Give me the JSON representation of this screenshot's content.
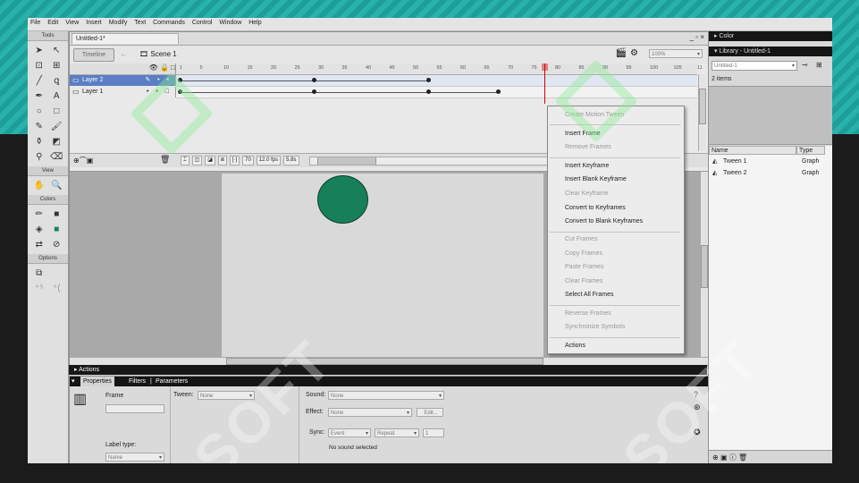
{
  "menu": [
    "File",
    "Edit",
    "View",
    "Insert",
    "Modify",
    "Text",
    "Commands",
    "Control",
    "Window",
    "Help"
  ],
  "tools": {
    "title": "Tools",
    "view_label": "View",
    "colors_label": "Colors",
    "options_label": "Options"
  },
  "document": {
    "tab": "Untitled-1*",
    "window_buttons": "_ ▫ ×"
  },
  "editbar": {
    "timeline_button": "Timeline",
    "scene": "Scene 1",
    "zoom": "100%"
  },
  "timeline": {
    "ruler": [
      "1",
      "5",
      "10",
      "15",
      "20",
      "25",
      "30",
      "35",
      "40",
      "45",
      "50",
      "55",
      "60",
      "65",
      "70",
      "75",
      "80",
      "85",
      "90",
      "95",
      "100",
      "105",
      "11"
    ],
    "layers": [
      {
        "name": "Layer 2",
        "selected": true
      },
      {
        "name": "Layer 1",
        "selected": false
      }
    ],
    "status": {
      "frame": "70",
      "fps": "12.0 fps",
      "time": "5.8s"
    }
  },
  "context_menu": [
    {
      "label": "Create Motion Tween",
      "enabled": false
    },
    {
      "label": "Insert Frame",
      "enabled": true
    },
    {
      "label": "Remove Frames",
      "enabled": false
    },
    {
      "label": "Insert Keyframe",
      "enabled": true
    },
    {
      "label": "Insert Blank Keyframe",
      "enabled": true
    },
    {
      "label": "Clear Keyframe",
      "enabled": false
    },
    {
      "label": "Convert to Keyframes",
      "enabled": true
    },
    {
      "label": "Convert to Blank Keyframes",
      "enabled": true
    },
    {
      "label": "Cut Frames",
      "enabled": false
    },
    {
      "label": "Copy Frames",
      "enabled": false
    },
    {
      "label": "Paste Frames",
      "enabled": false
    },
    {
      "label": "Clear Frames",
      "enabled": false
    },
    {
      "label": "Select All Frames",
      "enabled": true
    },
    {
      "label": "Reverse Frames",
      "enabled": false
    },
    {
      "label": "Synchronize Symbols",
      "enabled": false
    },
    {
      "label": "Actions",
      "enabled": true
    }
  ],
  "actions_panel": "Actions",
  "properties": {
    "tabs": [
      "Properties",
      "Filters",
      "Parameters"
    ],
    "frame_label": "Frame",
    "tween_label": "Tween:",
    "tween_value": "None",
    "sound_label": "Sound:",
    "sound_value": "None",
    "effect_label": "Effect:",
    "effect_value": "None",
    "edit_button": "Edit...",
    "sync_label": "Sync:",
    "sync_value": "Event",
    "repeat_value": "Repeat",
    "repeat_count": "1",
    "label_type_label": "Label type:",
    "label_type_value": "Name",
    "no_sound": "No sound selected"
  },
  "right_panel": {
    "color_header": "Color",
    "library_header": "Library - Untitled-1",
    "library_select": "Untitled-1",
    "items_count": "2 items",
    "col_name": "Name",
    "col_type": "Type",
    "items": [
      {
        "name": "Tween 1",
        "type": "Graph"
      },
      {
        "name": "Tween 2",
        "type": "Graph"
      }
    ]
  },
  "colors": {
    "circle": "#17805a",
    "selected_layer": "#5b7ec4"
  }
}
